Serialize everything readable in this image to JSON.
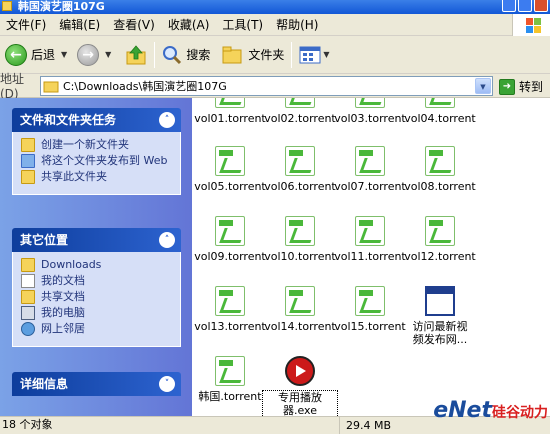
{
  "window": {
    "title": "韩国演艺圈107G"
  },
  "menu": {
    "items": [
      "文件(F)",
      "编辑(E)",
      "查看(V)",
      "收藏(A)",
      "工具(T)",
      "帮助(H)"
    ]
  },
  "toolbar": {
    "back_label": "后退",
    "search_label": "搜索",
    "folders_label": "文件夹"
  },
  "address": {
    "label": "地址(D)",
    "path": "C:\\Downloads\\韩国演艺圈107G",
    "go_label": "转到"
  },
  "sidebar": {
    "tasks": {
      "title": "文件和文件夹任务",
      "items": [
        {
          "label": "创建一个新文件夹",
          "icon": "new-folder-icon"
        },
        {
          "label": "将这个文件夹发布到 Web",
          "icon": "publish-icon"
        },
        {
          "label": "共享此文件夹",
          "icon": "share-icon"
        }
      ]
    },
    "places": {
      "title": "其它位置",
      "items": [
        {
          "label": "Downloads",
          "icon": "folder-icon"
        },
        {
          "label": "我的文档",
          "icon": "documents-icon"
        },
        {
          "label": "共享文档",
          "icon": "shared-docs-icon"
        },
        {
          "label": "我的电脑",
          "icon": "computer-icon"
        },
        {
          "label": "网上邻居",
          "icon": "network-icon"
        }
      ]
    },
    "details": {
      "title": "详细信息"
    }
  },
  "files": [
    {
      "name": "vol01.torrent",
      "type": "torrent"
    },
    {
      "name": "vol02.torrent",
      "type": "torrent"
    },
    {
      "name": "vol03.torrent",
      "type": "torrent"
    },
    {
      "name": "vol04.torrent",
      "type": "torrent"
    },
    {
      "name": "vol05.torrent",
      "type": "torrent"
    },
    {
      "name": "vol06.torrent",
      "type": "torrent"
    },
    {
      "name": "vol07.torrent",
      "type": "torrent"
    },
    {
      "name": "vol08.torrent",
      "type": "torrent"
    },
    {
      "name": "vol09.torrent",
      "type": "torrent"
    },
    {
      "name": "vol10.torrent",
      "type": "torrent"
    },
    {
      "name": "vol11.torrent",
      "type": "torrent"
    },
    {
      "name": "vol12.torrent",
      "type": "torrent"
    },
    {
      "name": "vol13.torrent",
      "type": "torrent"
    },
    {
      "name": "vol14.torrent",
      "type": "torrent"
    },
    {
      "name": "vol15.torrent",
      "type": "torrent"
    },
    {
      "name": "访问最新视频发布网...",
      "type": "web"
    },
    {
      "name": "韩国.torrent",
      "type": "torrent"
    },
    {
      "name": "专用播放器.exe",
      "type": "player"
    }
  ],
  "status": {
    "count": "18 个对象",
    "size": "29.4 MB"
  },
  "watermark": {
    "brand": "eNet",
    "suffix": "硅谷动力"
  },
  "colors": {
    "titlebar": "#1257d6",
    "sidebar": "#6375d6",
    "section_header": "#0d3d9c",
    "torrent_green": "#4ab83a"
  }
}
